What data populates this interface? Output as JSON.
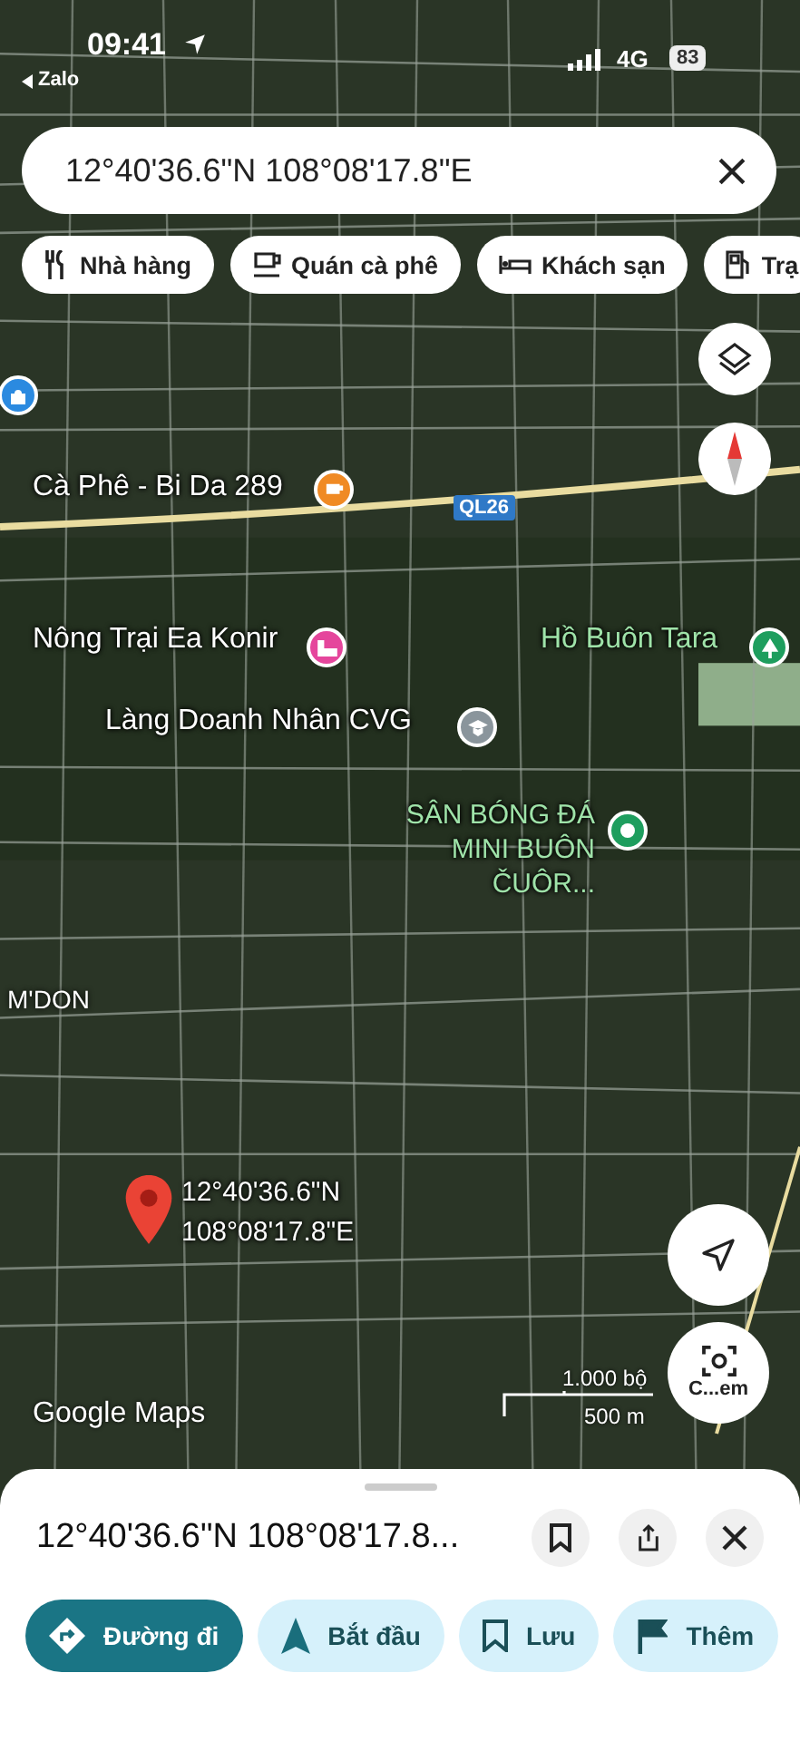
{
  "status_bar": {
    "time": "09:41",
    "back_app": "Zalo",
    "network": "4G",
    "battery": "83"
  },
  "search": {
    "value": "12°40'36.6\"N 108°08'17.8\"E"
  },
  "chips": [
    {
      "label": "Nhà hàng",
      "kind": "restaurant"
    },
    {
      "label": "Quán cà phê",
      "kind": "cafe"
    },
    {
      "label": "Khách sạn",
      "kind": "hotel"
    },
    {
      "label": "Trạ",
      "kind": "fuel"
    }
  ],
  "map": {
    "places": [
      {
        "name": "Cà Phê - Bi Da 289",
        "kind": "cafe",
        "color": "#f08a24"
      },
      {
        "name": "Nông Trại Ea Konir",
        "kind": "hotel",
        "color": "#e5469c"
      },
      {
        "name": "Hồ Buôn Tara",
        "kind": "park",
        "color": "#1e9e5e"
      },
      {
        "name": "Làng Doanh Nhân CVG",
        "kind": "school",
        "color": "#8a959c"
      },
      {
        "name": "SÂN BÓNG ĐÁ MINI BUÔN ČUÔR...",
        "kind": "sport",
        "color": "#1e9e5e"
      },
      {
        "kind": "shop",
        "color": "#2b8ae0"
      }
    ],
    "road_shield": "QL26",
    "area_label": "M'DON",
    "pin_label": [
      "12°40'36.6\"N",
      "108°08'17.8\"E"
    ],
    "logo": "Google Maps",
    "scale": {
      "top": "1.000 bộ",
      "bottom": "500 m"
    },
    "camera_label": "C...em"
  },
  "sheet": {
    "title": "12°40'36.6\"N 108°08'17.8...",
    "actions": [
      {
        "label": "Đường đi",
        "kind": "directions",
        "filled": true
      },
      {
        "label": "Bắt đầu",
        "kind": "start",
        "filled": false
      },
      {
        "label": "Lưu",
        "kind": "save",
        "filled": false
      },
      {
        "label": "Thêm",
        "kind": "flag",
        "filled": false
      }
    ]
  }
}
